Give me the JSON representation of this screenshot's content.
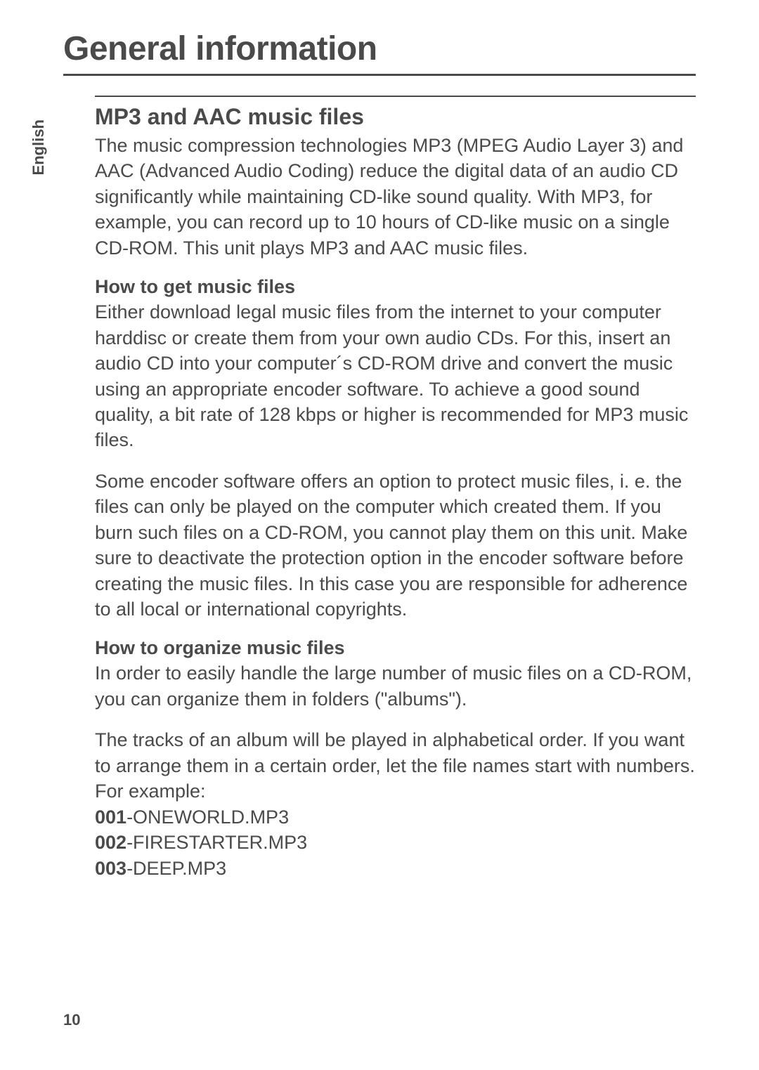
{
  "pageTitle": "General information",
  "languageTab": "English",
  "section": {
    "heading": "MP3 and AAC music files",
    "intro": "The music compression technologies MP3 (MPEG Audio Layer 3) and AAC (Advanced Audio Coding) reduce the digital data of an audio CD significantly while maintaining CD-like sound quality. With MP3, for example, you can record up to 10 hours of CD-like music on a single CD-ROM. This unit plays MP3 and AAC music files."
  },
  "subsection1": {
    "heading": "How to get music files",
    "para1": "Either download legal music files from the internet to your computer harddisc or create them from your own audio CDs. For this, insert an audio CD into your computer´s CD-ROM drive and convert the music using an appropriate encoder software. To achieve a good sound quality, a bit rate of 128 kbps or higher is recommended for MP3 music files.",
    "para2": "Some encoder software offers an option to protect music files, i. e. the files can only be played on the computer which created them. If you burn such files on a CD-ROM, you cannot play them on this unit. Make sure to deactivate the protection option in the encoder software before creating the music files. In this case you are responsible for adherence to all local or international copyrights."
  },
  "subsection2": {
    "heading": "How to organize music files",
    "para1": "In order to easily handle the large number of music files on a CD-ROM, you can organize them in folders (\"albums\").",
    "para2": "The tracks of an album will be played in alphabetical order. If you want to arrange them in a certain order, let the file names start with numbers. For example:",
    "examples": [
      {
        "num": "001",
        "rest": "-ONEWORLD.MP3"
      },
      {
        "num": "002",
        "rest": "-FIRESTARTER.MP3"
      },
      {
        "num": "003",
        "rest": "-DEEP.MP3"
      }
    ]
  },
  "pageNumber": "10"
}
